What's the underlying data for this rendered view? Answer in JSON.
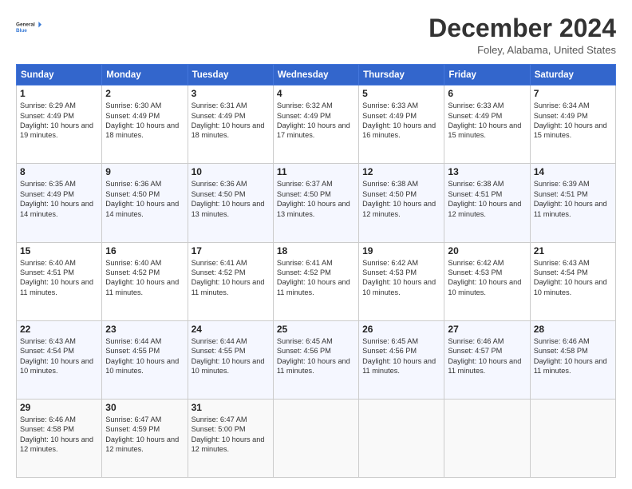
{
  "header": {
    "logo_line1": "General",
    "logo_line2": "Blue",
    "month_title": "December 2024",
    "location": "Foley, Alabama, United States"
  },
  "days_of_week": [
    "Sunday",
    "Monday",
    "Tuesday",
    "Wednesday",
    "Thursday",
    "Friday",
    "Saturday"
  ],
  "weeks": [
    [
      {
        "day": "1",
        "sunrise": "6:29 AM",
        "sunset": "4:49 PM",
        "daylight": "10 hours and 19 minutes."
      },
      {
        "day": "2",
        "sunrise": "6:30 AM",
        "sunset": "4:49 PM",
        "daylight": "10 hours and 18 minutes."
      },
      {
        "day": "3",
        "sunrise": "6:31 AM",
        "sunset": "4:49 PM",
        "daylight": "10 hours and 18 minutes."
      },
      {
        "day": "4",
        "sunrise": "6:32 AM",
        "sunset": "4:49 PM",
        "daylight": "10 hours and 17 minutes."
      },
      {
        "day": "5",
        "sunrise": "6:33 AM",
        "sunset": "4:49 PM",
        "daylight": "10 hours and 16 minutes."
      },
      {
        "day": "6",
        "sunrise": "6:33 AM",
        "sunset": "4:49 PM",
        "daylight": "10 hours and 15 minutes."
      },
      {
        "day": "7",
        "sunrise": "6:34 AM",
        "sunset": "4:49 PM",
        "daylight": "10 hours and 15 minutes."
      }
    ],
    [
      {
        "day": "8",
        "sunrise": "6:35 AM",
        "sunset": "4:49 PM",
        "daylight": "10 hours and 14 minutes."
      },
      {
        "day": "9",
        "sunrise": "6:36 AM",
        "sunset": "4:50 PM",
        "daylight": "10 hours and 14 minutes."
      },
      {
        "day": "10",
        "sunrise": "6:36 AM",
        "sunset": "4:50 PM",
        "daylight": "10 hours and 13 minutes."
      },
      {
        "day": "11",
        "sunrise": "6:37 AM",
        "sunset": "4:50 PM",
        "daylight": "10 hours and 13 minutes."
      },
      {
        "day": "12",
        "sunrise": "6:38 AM",
        "sunset": "4:50 PM",
        "daylight": "10 hours and 12 minutes."
      },
      {
        "day": "13",
        "sunrise": "6:38 AM",
        "sunset": "4:51 PM",
        "daylight": "10 hours and 12 minutes."
      },
      {
        "day": "14",
        "sunrise": "6:39 AM",
        "sunset": "4:51 PM",
        "daylight": "10 hours and 11 minutes."
      }
    ],
    [
      {
        "day": "15",
        "sunrise": "6:40 AM",
        "sunset": "4:51 PM",
        "daylight": "10 hours and 11 minutes."
      },
      {
        "day": "16",
        "sunrise": "6:40 AM",
        "sunset": "4:52 PM",
        "daylight": "10 hours and 11 minutes."
      },
      {
        "day": "17",
        "sunrise": "6:41 AM",
        "sunset": "4:52 PM",
        "daylight": "10 hours and 11 minutes."
      },
      {
        "day": "18",
        "sunrise": "6:41 AM",
        "sunset": "4:52 PM",
        "daylight": "10 hours and 11 minutes."
      },
      {
        "day": "19",
        "sunrise": "6:42 AM",
        "sunset": "4:53 PM",
        "daylight": "10 hours and 10 minutes."
      },
      {
        "day": "20",
        "sunrise": "6:42 AM",
        "sunset": "4:53 PM",
        "daylight": "10 hours and 10 minutes."
      },
      {
        "day": "21",
        "sunrise": "6:43 AM",
        "sunset": "4:54 PM",
        "daylight": "10 hours and 10 minutes."
      }
    ],
    [
      {
        "day": "22",
        "sunrise": "6:43 AM",
        "sunset": "4:54 PM",
        "daylight": "10 hours and 10 minutes."
      },
      {
        "day": "23",
        "sunrise": "6:44 AM",
        "sunset": "4:55 PM",
        "daylight": "10 hours and 10 minutes."
      },
      {
        "day": "24",
        "sunrise": "6:44 AM",
        "sunset": "4:55 PM",
        "daylight": "10 hours and 10 minutes."
      },
      {
        "day": "25",
        "sunrise": "6:45 AM",
        "sunset": "4:56 PM",
        "daylight": "10 hours and 11 minutes."
      },
      {
        "day": "26",
        "sunrise": "6:45 AM",
        "sunset": "4:56 PM",
        "daylight": "10 hours and 11 minutes."
      },
      {
        "day": "27",
        "sunrise": "6:46 AM",
        "sunset": "4:57 PM",
        "daylight": "10 hours and 11 minutes."
      },
      {
        "day": "28",
        "sunrise": "6:46 AM",
        "sunset": "4:58 PM",
        "daylight": "10 hours and 11 minutes."
      }
    ],
    [
      {
        "day": "29",
        "sunrise": "6:46 AM",
        "sunset": "4:58 PM",
        "daylight": "10 hours and 12 minutes."
      },
      {
        "day": "30",
        "sunrise": "6:47 AM",
        "sunset": "4:59 PM",
        "daylight": "10 hours and 12 minutes."
      },
      {
        "day": "31",
        "sunrise": "6:47 AM",
        "sunset": "5:00 PM",
        "daylight": "10 hours and 12 minutes."
      },
      null,
      null,
      null,
      null
    ]
  ]
}
